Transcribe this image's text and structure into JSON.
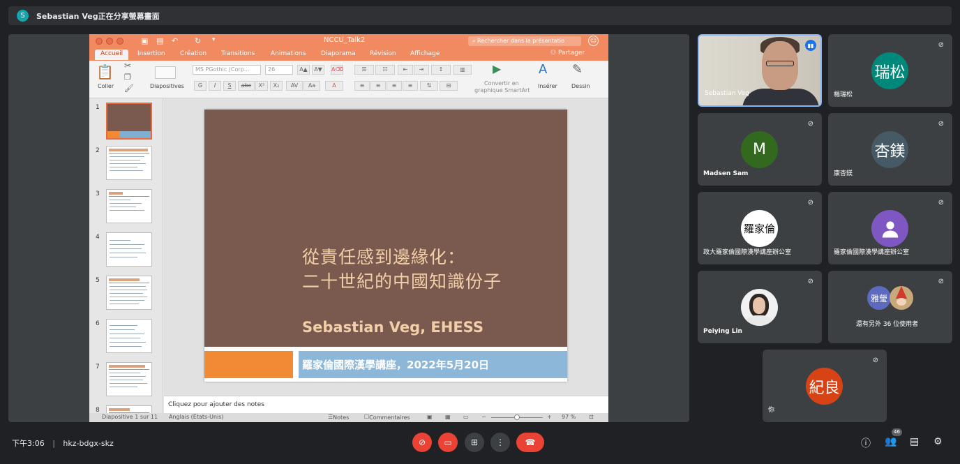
{
  "banner": {
    "avatar_letter": "S",
    "text": "Sebastian Veg正在分享螢幕畫面"
  },
  "ppt": {
    "title": "NCCU_Talk2",
    "search_placeholder": "Rechercher dans la présentatio",
    "tabs": [
      "Accueil",
      "Insertion",
      "Création",
      "Transitions",
      "Animations",
      "Diaporama",
      "Révision",
      "Affichage"
    ],
    "share_label": "Partager",
    "ribbon": {
      "paste_label": "Coller",
      "slides_label": "Diapositives",
      "font_name": "MS PGothic (Corp...",
      "font_size": "26",
      "smartart_label_1": "Convertir en",
      "smartart_label_2": "graphique SmartArt",
      "insert_label": "Insérer",
      "draw_label": "Dessin",
      "format_buttons": [
        "G",
        "I",
        "S",
        "abc",
        "X²",
        "X₂",
        "AV",
        "Aa",
        "A"
      ]
    },
    "thumbnails": [
      "1",
      "2",
      "3",
      "4",
      "5",
      "6",
      "7",
      "8"
    ],
    "slide": {
      "title_line1": "從責任感到邊緣化：",
      "title_line2": "二十世紀的中國知識份子",
      "author": "Sebastian Veg, EHESS",
      "subtitle": "羅家倫國際漢學講座，2022年5月20日"
    },
    "notes_placeholder": "Cliquez pour ajouter des notes",
    "status": {
      "slide_counter": "Diapositive 1 sur 11",
      "language": "Anglais (États-Unis)",
      "notes_btn": "Notes",
      "comments_btn": "Commentaires",
      "zoom": "97 %",
      "zoom_level": 0.5
    }
  },
  "participants": [
    {
      "name": "Sebastian Veg"
    },
    {
      "name": "楊瑞松",
      "initials": "瑞松",
      "color": "#00897b"
    },
    {
      "name": "Madsen Sam",
      "initials": "M",
      "color": "#33691e"
    },
    {
      "name": "康杏鎂",
      "initials": "杏鎂",
      "color": "#455a64"
    },
    {
      "name": "政大羅家倫國際漢學講座辦公室",
      "initials": "羅家倫",
      "color": "#ffffff"
    },
    {
      "name": "羅家倫國際漢學講座辦公室",
      "initials": "",
      "color": "#7e57c2"
    },
    {
      "name": "Peiying Lin",
      "initials": "",
      "color": "#f1f1f1"
    },
    {
      "name": "還有另外 36 位使用者",
      "initials": "雅瑩",
      "color": "#5c6bc0"
    },
    {
      "name": "你",
      "initials": "紀良",
      "color": "#d84315"
    }
  ],
  "bottom": {
    "time": "下午3:06",
    "meeting_code": "hkz-bdgx-skz",
    "participant_count": "46"
  }
}
